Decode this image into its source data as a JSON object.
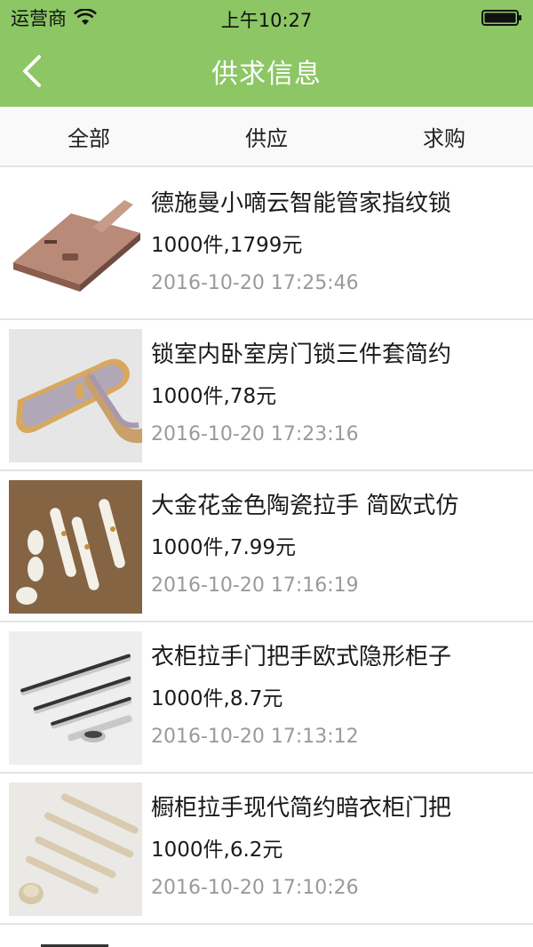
{
  "status_bar": {
    "carrier": "运营商",
    "time": "上午10:27",
    "wifi_icon": "wifi-icon",
    "battery_icon": "battery-icon"
  },
  "nav": {
    "title": "供求信息",
    "back_icon": "chevron-left-icon"
  },
  "tabs": [
    {
      "label": "全部"
    },
    {
      "label": "供应"
    },
    {
      "label": "求购"
    }
  ],
  "items": [
    {
      "title": "德施曼小嘀云智能管家指纹锁",
      "price": "1000件,1799元",
      "time": "2016-10-20 17:25:46",
      "image": "fingerprint-lock-image"
    },
    {
      "title": "锁室内卧室房门锁三件套简约",
      "price": "1000件,78元",
      "time": "2016-10-20 17:23:16",
      "image": "door-lock-image"
    },
    {
      "title": "大金花金色陶瓷拉手 简欧式仿",
      "price": "1000件,7.99元",
      "time": "2016-10-20 17:16:19",
      "image": "ceramic-handle-image"
    },
    {
      "title": "衣柜拉手门把手欧式隐形柜子",
      "price": "1000件,8.7元",
      "time": "2016-10-20 17:13:12",
      "image": "wardrobe-handle-image"
    },
    {
      "title": "橱柜拉手现代简约暗衣柜门把",
      "price": "1000件,6.2元",
      "time": "2016-10-20 17:10:26",
      "image": "cabinet-handle-image"
    }
  ],
  "colors": {
    "accent": "#8cc665",
    "title_text": "#ffffff",
    "time_text": "#9a9a9a"
  }
}
